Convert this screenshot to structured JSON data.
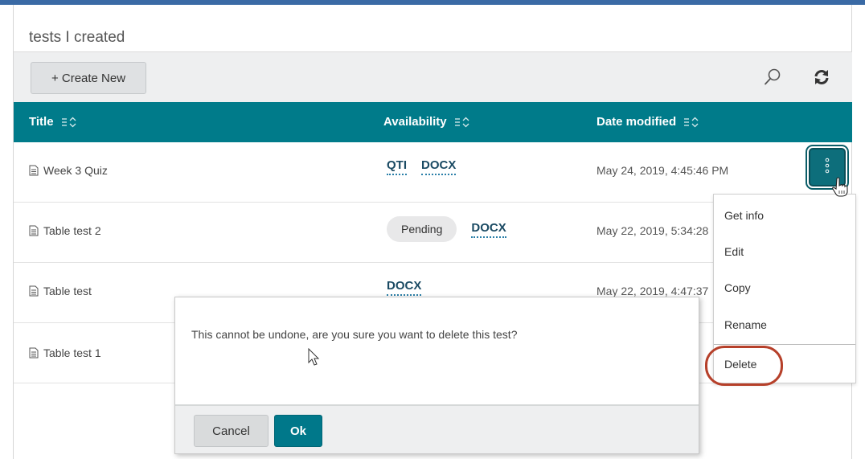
{
  "page": {
    "title": "tests I created"
  },
  "toolbar": {
    "create_label": "+ Create New",
    "search_icon": "search-icon",
    "refresh_icon": "refresh-icon"
  },
  "table": {
    "columns": [
      "Title",
      "Availability",
      "Date modified"
    ],
    "rows": [
      {
        "title": "Week 3 Quiz",
        "availability": [
          "QTI",
          "DOCX"
        ],
        "date": "May 24, 2019, 4:45:46 PM"
      },
      {
        "title": "Table test 2",
        "pending": "Pending",
        "availability": [
          "DOCX"
        ],
        "date": "May 22, 2019, 5:34:28"
      },
      {
        "title": "Table test",
        "availability": [
          "DOCX"
        ],
        "date": "May 22, 2019, 4:47:37"
      },
      {
        "title": "Table test 1"
      }
    ]
  },
  "menu": {
    "items": [
      "Get info",
      "Edit",
      "Copy",
      "Rename",
      "Delete"
    ]
  },
  "dialog": {
    "message": "This cannot be undone, are you sure you want to delete this test?",
    "cancel_label": "Cancel",
    "ok_label": "Ok"
  },
  "colors": {
    "header_teal": "#007b8a",
    "ok_button": "#00788a",
    "highlight_circle": "#b6402a",
    "link_text": "#1a4a63"
  }
}
